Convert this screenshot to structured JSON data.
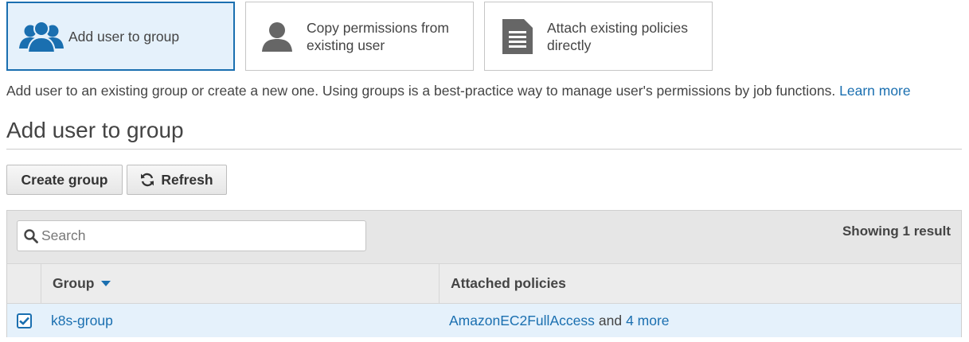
{
  "options": [
    {
      "label": "Add user to group",
      "icon": "users-group-icon",
      "selected": true
    },
    {
      "label": "Copy permissions from existing user",
      "icon": "user-silhouette-icon",
      "selected": false
    },
    {
      "label": "Attach existing policies directly",
      "icon": "document-icon",
      "selected": false
    }
  ],
  "description": {
    "text": "Add user to an existing group or create a new one. Using groups is a best-practice way to manage user's permissions by job functions.",
    "link": "Learn more"
  },
  "section_title": "Add user to group",
  "toolbar": {
    "create_label": "Create group",
    "refresh_label": "Refresh"
  },
  "table": {
    "search_placeholder": "Search",
    "showing": "Showing 1 result",
    "columns": {
      "group": "Group",
      "policies": "Attached policies"
    },
    "rows": [
      {
        "checked": true,
        "group": "k8s-group",
        "policy": "AmazonEC2FullAccess",
        "and": "and",
        "more": "4 more"
      }
    ]
  },
  "colors": {
    "accent": "#1a6fb0",
    "selected_bg": "#e5f1fb"
  }
}
